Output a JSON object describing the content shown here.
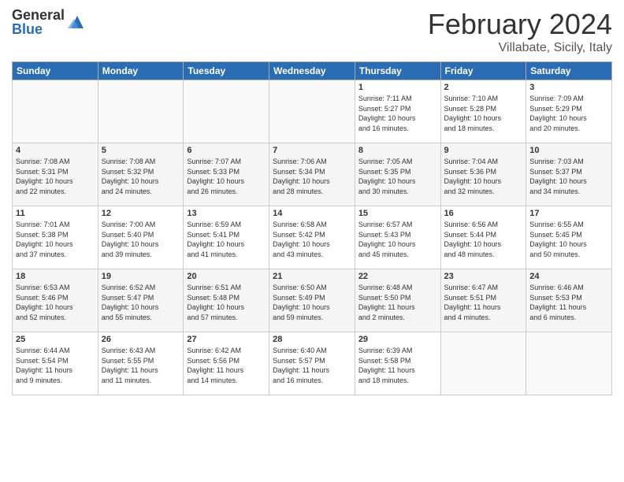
{
  "logo": {
    "general": "General",
    "blue": "Blue"
  },
  "title": "February 2024",
  "location": "Villabate, Sicily, Italy",
  "days_header": [
    "Sunday",
    "Monday",
    "Tuesday",
    "Wednesday",
    "Thursday",
    "Friday",
    "Saturday"
  ],
  "weeks": [
    [
      {
        "day": "",
        "info": ""
      },
      {
        "day": "",
        "info": ""
      },
      {
        "day": "",
        "info": ""
      },
      {
        "day": "",
        "info": ""
      },
      {
        "day": "1",
        "info": "Sunrise: 7:11 AM\nSunset: 5:27 PM\nDaylight: 10 hours\nand 16 minutes."
      },
      {
        "day": "2",
        "info": "Sunrise: 7:10 AM\nSunset: 5:28 PM\nDaylight: 10 hours\nand 18 minutes."
      },
      {
        "day": "3",
        "info": "Sunrise: 7:09 AM\nSunset: 5:29 PM\nDaylight: 10 hours\nand 20 minutes."
      }
    ],
    [
      {
        "day": "4",
        "info": "Sunrise: 7:08 AM\nSunset: 5:31 PM\nDaylight: 10 hours\nand 22 minutes."
      },
      {
        "day": "5",
        "info": "Sunrise: 7:08 AM\nSunset: 5:32 PM\nDaylight: 10 hours\nand 24 minutes."
      },
      {
        "day": "6",
        "info": "Sunrise: 7:07 AM\nSunset: 5:33 PM\nDaylight: 10 hours\nand 26 minutes."
      },
      {
        "day": "7",
        "info": "Sunrise: 7:06 AM\nSunset: 5:34 PM\nDaylight: 10 hours\nand 28 minutes."
      },
      {
        "day": "8",
        "info": "Sunrise: 7:05 AM\nSunset: 5:35 PM\nDaylight: 10 hours\nand 30 minutes."
      },
      {
        "day": "9",
        "info": "Sunrise: 7:04 AM\nSunset: 5:36 PM\nDaylight: 10 hours\nand 32 minutes."
      },
      {
        "day": "10",
        "info": "Sunrise: 7:03 AM\nSunset: 5:37 PM\nDaylight: 10 hours\nand 34 minutes."
      }
    ],
    [
      {
        "day": "11",
        "info": "Sunrise: 7:01 AM\nSunset: 5:38 PM\nDaylight: 10 hours\nand 37 minutes."
      },
      {
        "day": "12",
        "info": "Sunrise: 7:00 AM\nSunset: 5:40 PM\nDaylight: 10 hours\nand 39 minutes."
      },
      {
        "day": "13",
        "info": "Sunrise: 6:59 AM\nSunset: 5:41 PM\nDaylight: 10 hours\nand 41 minutes."
      },
      {
        "day": "14",
        "info": "Sunrise: 6:58 AM\nSunset: 5:42 PM\nDaylight: 10 hours\nand 43 minutes."
      },
      {
        "day": "15",
        "info": "Sunrise: 6:57 AM\nSunset: 5:43 PM\nDaylight: 10 hours\nand 45 minutes."
      },
      {
        "day": "16",
        "info": "Sunrise: 6:56 AM\nSunset: 5:44 PM\nDaylight: 10 hours\nand 48 minutes."
      },
      {
        "day": "17",
        "info": "Sunrise: 6:55 AM\nSunset: 5:45 PM\nDaylight: 10 hours\nand 50 minutes."
      }
    ],
    [
      {
        "day": "18",
        "info": "Sunrise: 6:53 AM\nSunset: 5:46 PM\nDaylight: 10 hours\nand 52 minutes."
      },
      {
        "day": "19",
        "info": "Sunrise: 6:52 AM\nSunset: 5:47 PM\nDaylight: 10 hours\nand 55 minutes."
      },
      {
        "day": "20",
        "info": "Sunrise: 6:51 AM\nSunset: 5:48 PM\nDaylight: 10 hours\nand 57 minutes."
      },
      {
        "day": "21",
        "info": "Sunrise: 6:50 AM\nSunset: 5:49 PM\nDaylight: 10 hours\nand 59 minutes."
      },
      {
        "day": "22",
        "info": "Sunrise: 6:48 AM\nSunset: 5:50 PM\nDaylight: 11 hours\nand 2 minutes."
      },
      {
        "day": "23",
        "info": "Sunrise: 6:47 AM\nSunset: 5:51 PM\nDaylight: 11 hours\nand 4 minutes."
      },
      {
        "day": "24",
        "info": "Sunrise: 6:46 AM\nSunset: 5:53 PM\nDaylight: 11 hours\nand 6 minutes."
      }
    ],
    [
      {
        "day": "25",
        "info": "Sunrise: 6:44 AM\nSunset: 5:54 PM\nDaylight: 11 hours\nand 9 minutes."
      },
      {
        "day": "26",
        "info": "Sunrise: 6:43 AM\nSunset: 5:55 PM\nDaylight: 11 hours\nand 11 minutes."
      },
      {
        "day": "27",
        "info": "Sunrise: 6:42 AM\nSunset: 5:56 PM\nDaylight: 11 hours\nand 14 minutes."
      },
      {
        "day": "28",
        "info": "Sunrise: 6:40 AM\nSunset: 5:57 PM\nDaylight: 11 hours\nand 16 minutes."
      },
      {
        "day": "29",
        "info": "Sunrise: 6:39 AM\nSunset: 5:58 PM\nDaylight: 11 hours\nand 18 minutes."
      },
      {
        "day": "",
        "info": ""
      },
      {
        "day": "",
        "info": ""
      }
    ]
  ]
}
